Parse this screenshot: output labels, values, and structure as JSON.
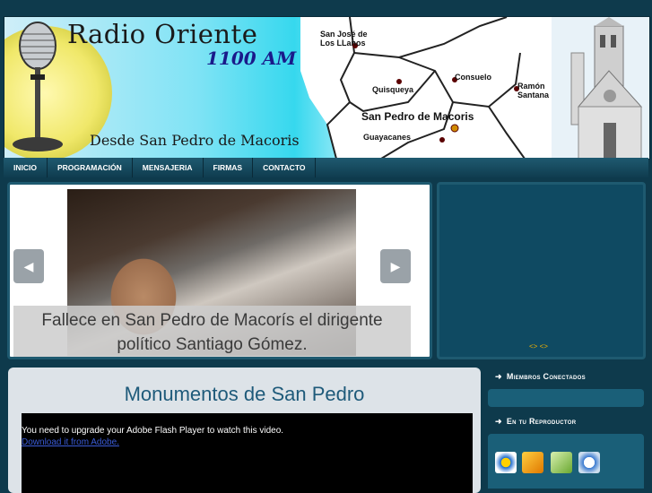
{
  "header": {
    "title": "Radio Oriente",
    "frequency": "1100 AM",
    "subtitle": "Desde San Pedro de Macoris",
    "map_labels": {
      "san_jose": "San José de\nLos LLanos",
      "quisqueya": "Quisqueya",
      "consuelo": "Consuelo",
      "ramon_santana": "Ramón\nSantana",
      "san_pedro": "San Pedro de Macoris",
      "guayacanes": "Guayacanes"
    }
  },
  "nav": {
    "items": [
      "INICIO",
      "PROGRAMACIÓN",
      "MENSAJERIA",
      "FIRMAS",
      "CONTACTO"
    ]
  },
  "slider": {
    "caption": "Fallece en San Pedro de Macorís el dirigente político Santiago Gómez.",
    "prev_icon": "chevron-left-icon",
    "next_icon": "chevron-right-icon"
  },
  "side_panel": {
    "nav_text": "<> <>"
  },
  "content": {
    "title": "Monumentos de San Pedro",
    "flash_message": "You need to upgrade your Adobe Flash Player to watch this video.",
    "flash_link": "Download it from Adobe."
  },
  "sidebar": {
    "members_heading": "Miembros Conectados",
    "player_heading": "En tu Reproductor",
    "player_icons": [
      "windows-media-player-icon",
      "winamp-icon",
      "itunes-icon",
      "realplayer-icon"
    ]
  },
  "colors": {
    "page_bg": "#0e3a4c",
    "nav_bg": "#1f5a70",
    "panel_bg": "#0f4a62",
    "content_bg": "#dde3e8",
    "title_blue": "#1e5a7a",
    "accent_orange": "#f0b000"
  }
}
